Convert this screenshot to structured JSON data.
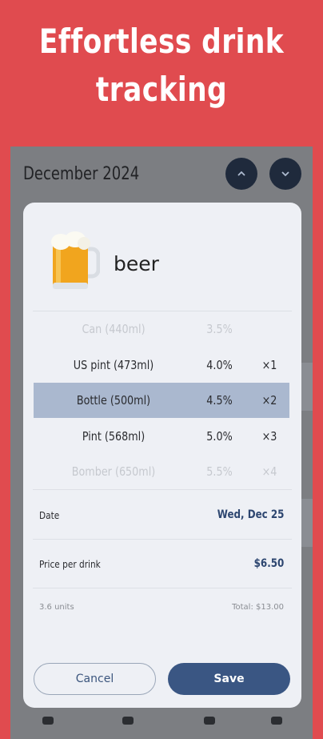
{
  "headline": {
    "line1": "Effortless drink",
    "line2": "tracking"
  },
  "calendar": {
    "month_label": "December 2024"
  },
  "dialog": {
    "drink_name": "beer",
    "sizes": [
      {
        "size": "Can (440ml)",
        "abv": "3.5%",
        "qty": ""
      },
      {
        "size": "US pint (473ml)",
        "abv": "4.0%",
        "qty": "×1"
      },
      {
        "size": "Bottle (500ml)",
        "abv": "4.5%",
        "qty": "×2"
      },
      {
        "size": "Pint (568ml)",
        "abv": "5.0%",
        "qty": "×3"
      },
      {
        "size": "Bomber (650ml)",
        "abv": "5.5%",
        "qty": "×4"
      }
    ],
    "date_label": "Date",
    "date_value": "Wed, Dec 25",
    "price_label": "Price per drink",
    "price_value": "$6.50",
    "units_text": "3.6 units",
    "total_text": "Total: $13.00",
    "cancel_label": "Cancel",
    "save_label": "Save"
  },
  "colors": {
    "background": "#e04b4f",
    "accent": "#3a5683",
    "selected_row": "#aab8cf",
    "dialog_bg": "#eef0f5"
  }
}
